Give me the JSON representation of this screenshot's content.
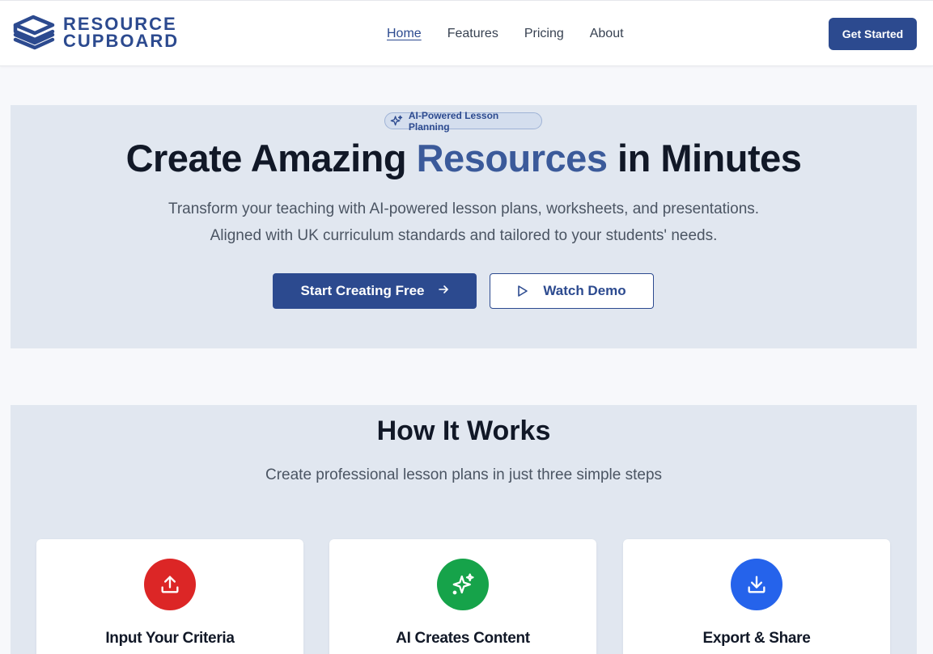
{
  "brand": {
    "name_line1": "RESOURCE",
    "name_line2": "CUPBOARD",
    "color": "#2c4a8f"
  },
  "nav": {
    "items": [
      {
        "label": "Home",
        "active": true
      },
      {
        "label": "Features",
        "active": false
      },
      {
        "label": "Pricing",
        "active": false
      },
      {
        "label": "About",
        "active": false
      }
    ],
    "cta_label": "Get Started"
  },
  "hero": {
    "badge": "AI-Powered Lesson Planning",
    "title_before": "Create Amazing ",
    "title_accent": "Resources",
    "title_after": " in Minutes",
    "subtitle_line1": "Transform your teaching with AI-powered lesson plans, worksheets, and presentations.",
    "subtitle_line2": "Aligned with UK curriculum standards and tailored to your students' needs.",
    "primary_cta": "Start Creating Free",
    "secondary_cta": "Watch Demo"
  },
  "how": {
    "title": "How It Works",
    "subtitle": "Create professional lesson plans in just three simple steps",
    "steps": [
      {
        "title": "Input Your Criteria",
        "icon": "upload-icon",
        "color": "#dc2626"
      },
      {
        "title": "AI Creates Content",
        "icon": "sparkles-icon",
        "color": "#16a34a"
      },
      {
        "title": "Export & Share",
        "icon": "download-icon",
        "color": "#2563eb"
      }
    ]
  }
}
